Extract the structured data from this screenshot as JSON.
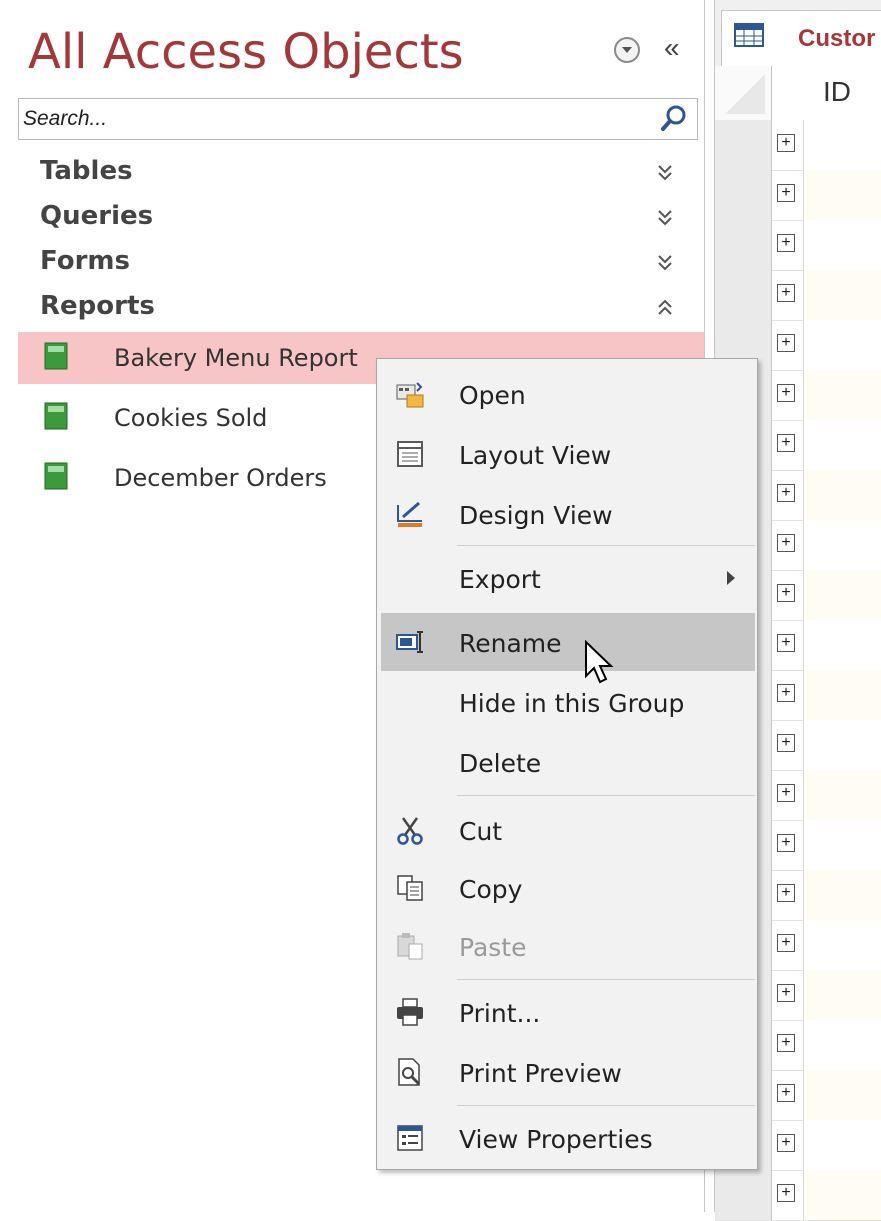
{
  "nav": {
    "title": "All Access Objects",
    "search_placeholder": "Search...",
    "groups": [
      {
        "label": "Tables",
        "state": "collapsed"
      },
      {
        "label": "Queries",
        "state": "collapsed"
      },
      {
        "label": "Forms",
        "state": "collapsed"
      },
      {
        "label": "Reports",
        "state": "expanded"
      }
    ],
    "reports": [
      {
        "label": "Bakery Menu Report",
        "selected": true
      },
      {
        "label": "Cookies Sold",
        "selected": false
      },
      {
        "label": "December Orders",
        "selected": false
      }
    ]
  },
  "datasheet": {
    "tab_label": "Custor",
    "column_header": "ID",
    "row_count": 22
  },
  "context_menu": {
    "items": [
      {
        "label": "Open",
        "icon": "open-icon",
        "enabled": true
      },
      {
        "label": "Layout View",
        "icon": "layout-view-icon",
        "enabled": true
      },
      {
        "label": "Design View",
        "icon": "design-view-icon",
        "enabled": true
      },
      {
        "label": "Export",
        "icon": "",
        "enabled": true,
        "submenu": true
      },
      {
        "label": "Rename",
        "icon": "rename-icon",
        "enabled": true,
        "highlighted": true
      },
      {
        "label": "Hide in this Group",
        "icon": "",
        "enabled": true
      },
      {
        "label": "Delete",
        "icon": "",
        "enabled": true
      },
      {
        "label": "Cut",
        "icon": "scissors-icon",
        "enabled": true
      },
      {
        "label": "Copy",
        "icon": "copy-icon",
        "enabled": true
      },
      {
        "label": "Paste",
        "icon": "paste-icon",
        "enabled": false
      },
      {
        "label": "Print...",
        "icon": "printer-icon",
        "enabled": true
      },
      {
        "label": "Print Preview",
        "icon": "print-preview-icon",
        "enabled": true
      },
      {
        "label": "View Properties",
        "icon": "properties-icon",
        "enabled": true
      }
    ]
  },
  "colors": {
    "accent": "#a4373a",
    "selection": "#f7c5c5",
    "menu_highlight": "#c6c6c6"
  }
}
